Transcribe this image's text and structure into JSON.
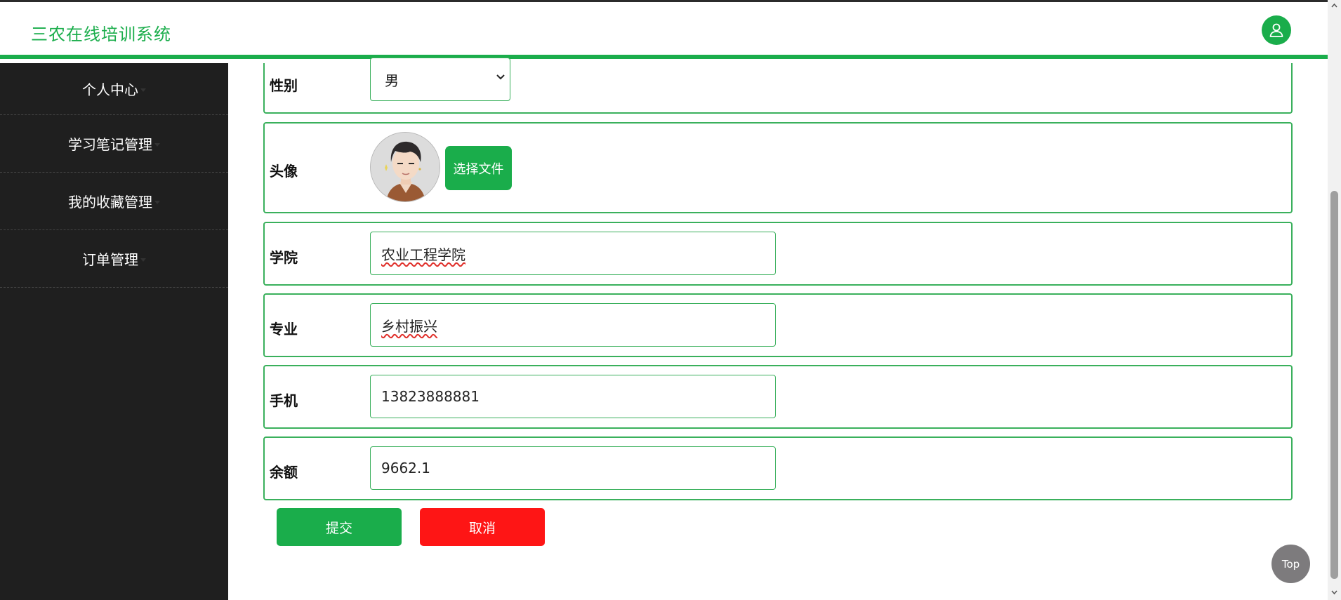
{
  "app": {
    "title": "三农在线培训系统"
  },
  "header": {
    "user_icon": "user-icon"
  },
  "sidebar": {
    "items": [
      {
        "label": "个人中心"
      },
      {
        "label": "学习笔记管理"
      },
      {
        "label": "我的收藏管理"
      },
      {
        "label": "订单管理"
      }
    ]
  },
  "form": {
    "gender": {
      "label": "性别",
      "value": "男"
    },
    "avatar": {
      "label": "头像",
      "button_label": "选择文件"
    },
    "college": {
      "label": "学院",
      "value": "农业工程学院"
    },
    "major": {
      "label": "专业",
      "value": "乡村振兴"
    },
    "phone": {
      "label": "手机",
      "value": "13823888881"
    },
    "balance": {
      "label": "余额",
      "value": "9662.1"
    }
  },
  "actions": {
    "submit_label": "提交",
    "cancel_label": "取消"
  },
  "back_to_top": {
    "label": "Top"
  },
  "colors": {
    "accent": "#1aad4b",
    "danger": "#fe1515",
    "sidebar": "#1f1f1f"
  }
}
